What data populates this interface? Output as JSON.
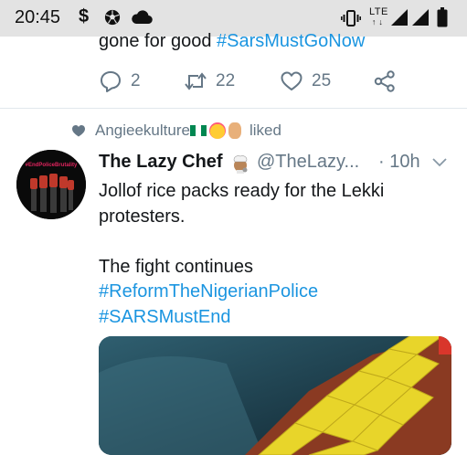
{
  "status_bar": {
    "time": "20:45",
    "network_label": "LTE",
    "icons": [
      "dollar-icon",
      "soccer-ball-icon",
      "cloud-icon",
      "vibrate-icon",
      "lte-icon",
      "signal-icon",
      "signal-icon",
      "battery-icon"
    ]
  },
  "previous_tweet": {
    "text_plain": "gone for good",
    "hashtag": "#SarsMustGoNow",
    "reply_count": "2",
    "retweet_count": "22",
    "like_count": "25"
  },
  "liked_context": {
    "user": "Angieekulture",
    "action": "liked"
  },
  "tweet": {
    "author_name": "The Lazy Chef",
    "handle": "@TheLazy...",
    "time": "· 10h",
    "avatar_caption": "#EndPoliceBrutality",
    "body": {
      "line1": "Jollof rice packs ready for the Lekki",
      "line2": "protesters.",
      "line3": "The fight continues",
      "hashtag1": "#ReformTheNigerianPolice",
      "hashtag2": "#SARSMustEnd"
    }
  },
  "colors": {
    "link": "#1b95e0",
    "secondary_text": "#657786",
    "primary_text": "#14171a",
    "status_bar_bg": "#e3e3e3"
  }
}
